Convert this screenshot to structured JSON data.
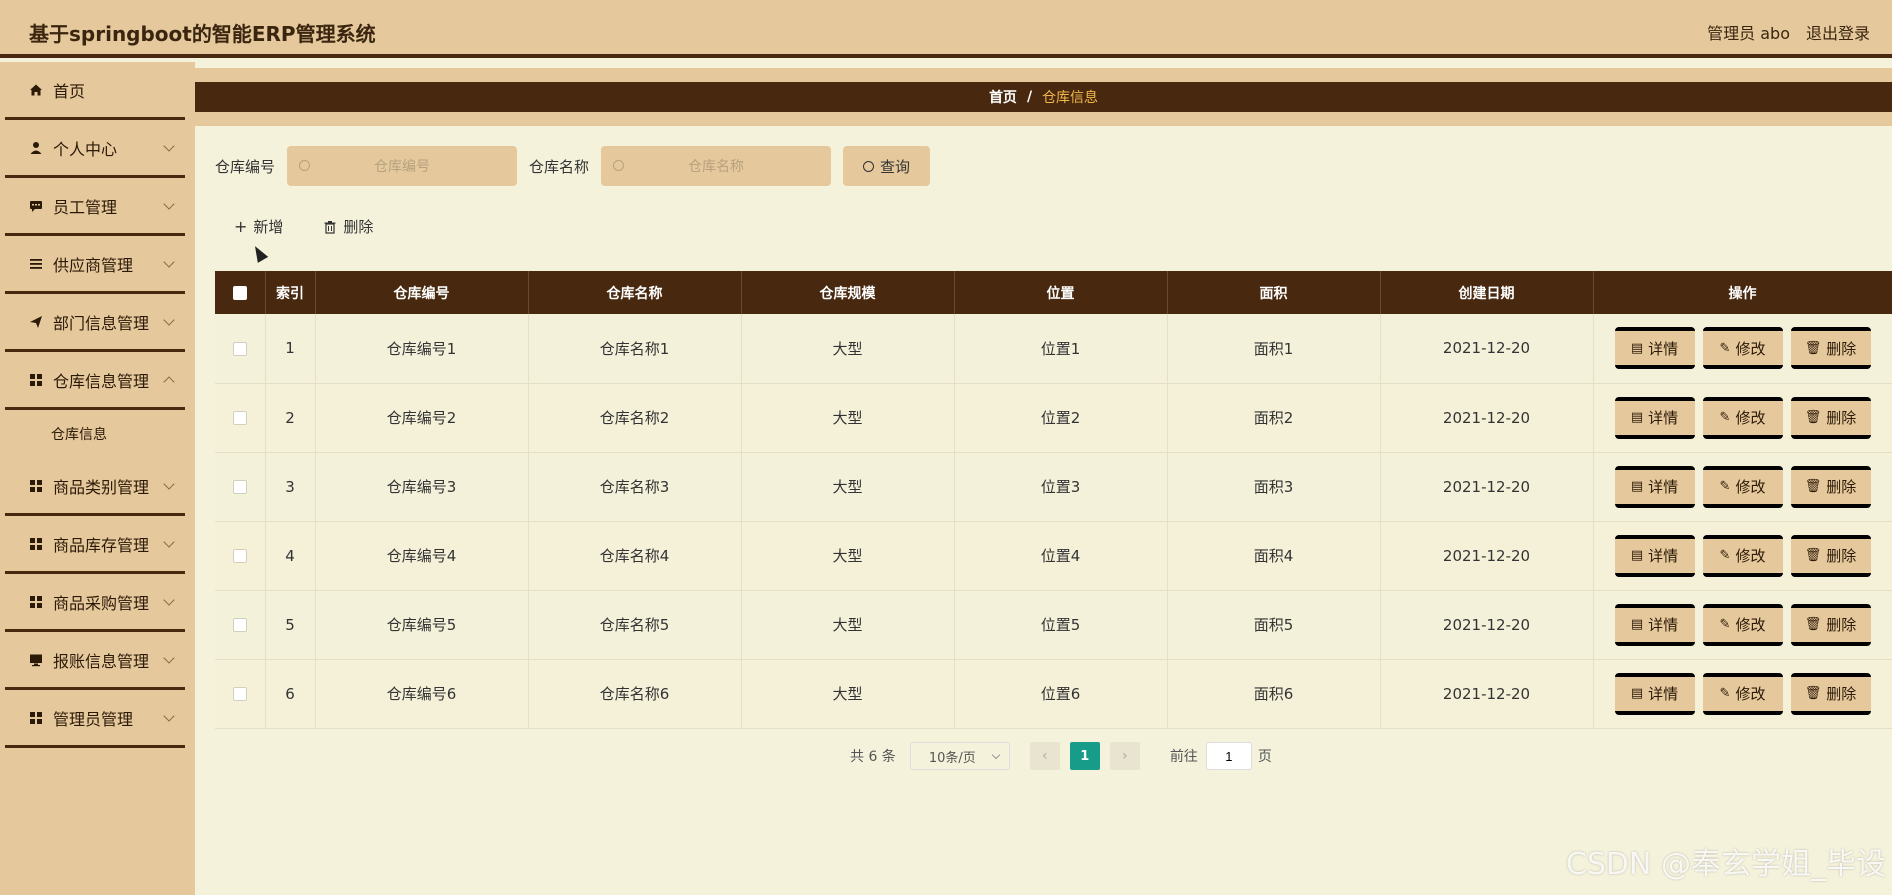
{
  "header": {
    "title": "基于springboot的智能ERP管理系统",
    "user": "管理员 abo",
    "logout": "退出登录"
  },
  "sidebar": {
    "items": [
      {
        "label": "首页",
        "icon": "home-icon"
      },
      {
        "label": "个人中心",
        "icon": "user-icon"
      },
      {
        "label": "员工管理",
        "icon": "chat-icon"
      },
      {
        "label": "供应商管理",
        "icon": "list-icon"
      },
      {
        "label": "部门信息管理",
        "icon": "send-icon"
      },
      {
        "label": "仓库信息管理",
        "icon": "grid-icon"
      },
      {
        "label": "商品类别管理",
        "icon": "grid-icon"
      },
      {
        "label": "商品库存管理",
        "icon": "grid-icon"
      },
      {
        "label": "商品采购管理",
        "icon": "grid-icon"
      },
      {
        "label": "报账信息管理",
        "icon": "monitor-icon"
      },
      {
        "label": "管理员管理",
        "icon": "grid-icon"
      }
    ],
    "subitem": "仓库信息"
  },
  "breadcrumb": {
    "home": "首页",
    "sep": "/",
    "current": "仓库信息"
  },
  "search": {
    "label1": "仓库编号",
    "placeholder1": "仓库编号",
    "label2": "仓库名称",
    "placeholder2": "仓库名称",
    "button": "查询"
  },
  "actions": {
    "add": "新增",
    "delete": "删除"
  },
  "table": {
    "columns": [
      "索引",
      "仓库编号",
      "仓库名称",
      "仓库规模",
      "位置",
      "面积",
      "创建日期",
      "操作"
    ],
    "rows": [
      {
        "index": "1",
        "code": "仓库编号1",
        "name": "仓库名称1",
        "scale": "大型",
        "location": "位置1",
        "area": "面积1",
        "date": "2021-12-20"
      },
      {
        "index": "2",
        "code": "仓库编号2",
        "name": "仓库名称2",
        "scale": "大型",
        "location": "位置2",
        "area": "面积2",
        "date": "2021-12-20"
      },
      {
        "index": "3",
        "code": "仓库编号3",
        "name": "仓库名称3",
        "scale": "大型",
        "location": "位置3",
        "area": "面积3",
        "date": "2021-12-20"
      },
      {
        "index": "4",
        "code": "仓库编号4",
        "name": "仓库名称4",
        "scale": "大型",
        "location": "位置4",
        "area": "面积4",
        "date": "2021-12-20"
      },
      {
        "index": "5",
        "code": "仓库编号5",
        "name": "仓库名称5",
        "scale": "大型",
        "location": "位置5",
        "area": "面积5",
        "date": "2021-12-20"
      },
      {
        "index": "6",
        "code": "仓库编号6",
        "name": "仓库名称6",
        "scale": "大型",
        "location": "位置6",
        "area": "面积6",
        "date": "2021-12-20"
      }
    ],
    "ops": {
      "detail": "详情",
      "edit": "修改",
      "delete": "删除"
    }
  },
  "pagination": {
    "total": "共 6 条",
    "page_size": "10条/页",
    "current_page": "1",
    "goto_label": "前往",
    "goto_value": "1",
    "page_suffix": "页"
  },
  "watermark": "CSDN @奉玄学姐_毕设",
  "colors": {
    "accent_dark": "#48290f",
    "accent_light": "#e5c89b",
    "background": "#f5f2dc",
    "page_active": "#169c88"
  }
}
